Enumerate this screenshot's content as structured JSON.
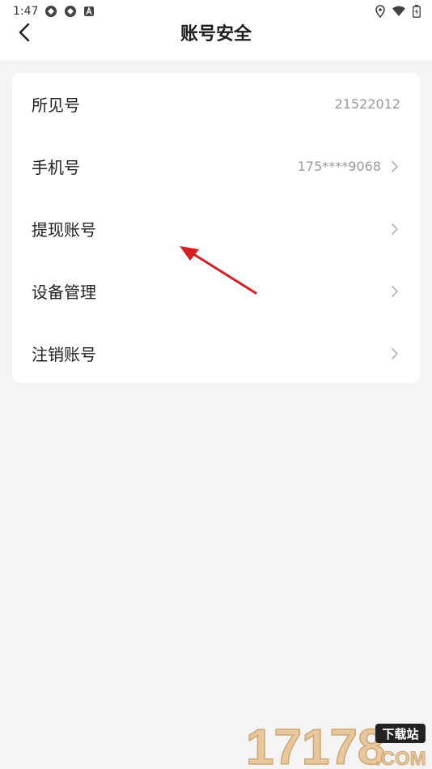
{
  "status_bar": {
    "time": "1:47"
  },
  "header": {
    "title": "账号安全"
  },
  "settings": {
    "items": [
      {
        "label": "所见号",
        "value": "21522012",
        "has_chevron": false
      },
      {
        "label": "手机号",
        "value": "175****9068",
        "has_chevron": true
      },
      {
        "label": "提现账号",
        "value": "",
        "has_chevron": true
      },
      {
        "label": "设备管理",
        "value": "",
        "has_chevron": true
      },
      {
        "label": "注销账号",
        "value": "",
        "has_chevron": true
      }
    ]
  },
  "watermark": {
    "number": "17178",
    "badge": "下载站",
    "domain": ".COM"
  },
  "colors": {
    "annotation_arrow": "#d62020",
    "value_text": "#9a9a9a",
    "chevron": "#b5b5b5",
    "watermark": "#e6c090"
  }
}
